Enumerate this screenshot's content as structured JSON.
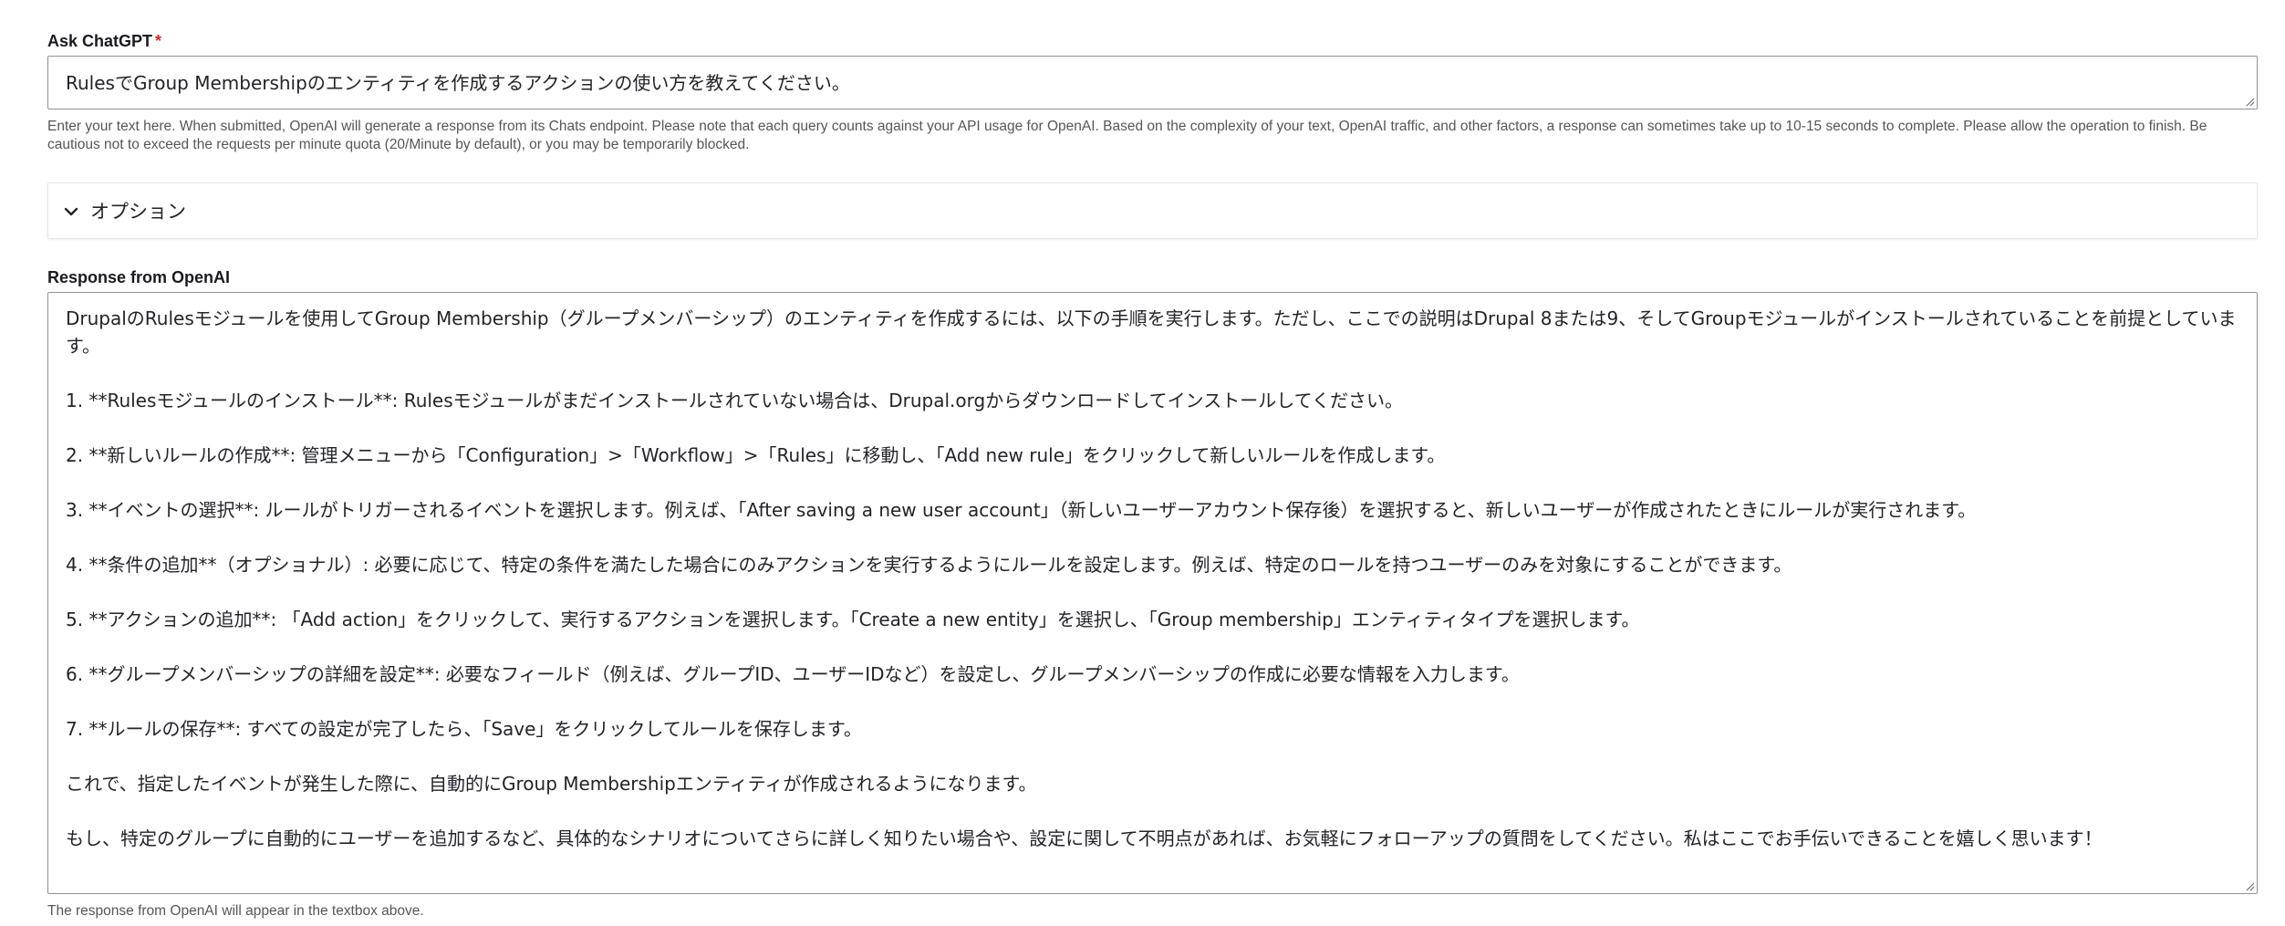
{
  "ask_label": "Ask ChatGPT",
  "ask_required_mark": "*",
  "ask_value": "RulesでGroup Membershipのエンティティを作成するアクションの使い方を教えてください。",
  "ask_help": "Enter your text here. When submitted, OpenAI will generate a response from its Chats endpoint. Please note that each query counts against your API usage for OpenAI. Based on the complexity of your text, OpenAI traffic, and other factors, a response can sometimes take up to 10-15 seconds to complete. Please allow the operation to finish. Be cautious not to exceed the requests per minute quota (20/Minute by default), or you may be temporarily blocked.",
  "options_label": "オプション",
  "response_label": "Response from OpenAI",
  "response_lines": [
    "DrupalのRulesモジュールを使用してGroup Membership（グループメンバーシップ）のエンティティを作成するには、以下の手順を実行します。ただし、ここでの説明はDrupal 8または9、そしてGroupモジュールがインストールされていることを前提としています。",
    "",
    "1. **Rulesモジュールのインストール**: Rulesモジュールがまだインストールされていない場合は、Drupal.orgからダウンロードしてインストールしてください。",
    "",
    "2. **新しいルールの作成**: 管理メニューから「Configuration」>「Workflow」>「Rules」に移動し、「Add new rule」をクリックして新しいルールを作成します。",
    "",
    "3. **イベントの選択**: ルールがトリガーされるイベントを選択します。例えば、「After saving a new user account」（新しいユーザーアカウント保存後）を選択すると、新しいユーザーが作成されたときにルールが実行されます。",
    "",
    "4. **条件の追加**（オプショナル）: 必要に応じて、特定の条件を満たした場合にのみアクションを実行するようにルールを設定します。例えば、特定のロールを持つユーザーのみを対象にすることができます。",
    "",
    "5. **アクションの追加**: 「Add action」をクリックして、実行するアクションを選択します。「Create a new entity」を選択し、「Group membership」エンティティタイプを選択します。",
    "",
    "6. **グループメンバーシップの詳細を設定**: 必要なフィールド（例えば、グループID、ユーザーIDなど）を設定し、グループメンバーシップの作成に必要な情報を入力します。",
    "",
    "7. **ルールの保存**: すべての設定が完了したら、「Save」をクリックしてルールを保存します。",
    "",
    "これで、指定したイベントが発生した際に、自動的にGroup Membershipエンティティが作成されるようになります。",
    "",
    "もし、特定のグループに自動的にユーザーを追加するなど、具体的なシナリオについてさらに詳しく知りたい場合や、設定に関して不明点があれば、お気軽にフォローアップの質問をしてください。私はここでお手伝いできることを嬉しく思います！"
  ],
  "response_help": "The response from OpenAI will appear in the textbox above.",
  "icons": {
    "options_toggle": "chevron-down-icon",
    "resize": "resize-grip-icon"
  },
  "colors": {
    "required": "#dc2323",
    "border": "#8e929c",
    "text": "#232429",
    "help_text": "#55565b"
  }
}
